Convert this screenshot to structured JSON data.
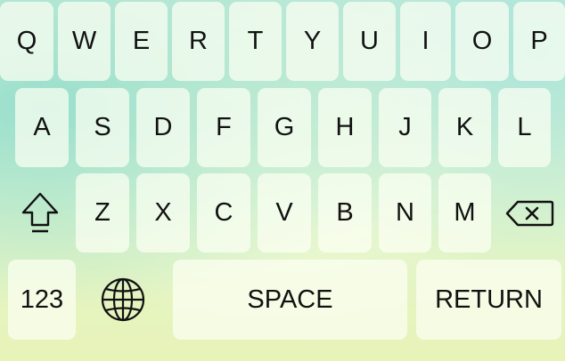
{
  "keyboard": {
    "row1": [
      "Q",
      "W",
      "E",
      "R",
      "T",
      "Y",
      "U",
      "I",
      "O",
      "P"
    ],
    "row2": [
      "A",
      "S",
      "D",
      "F",
      "G",
      "H",
      "J",
      "K",
      "L"
    ],
    "row3": [
      "Z",
      "X",
      "C",
      "V",
      "B",
      "N",
      "M"
    ],
    "numbers_label": "123",
    "space_label": "SPACE",
    "return_label": "RETURN",
    "icons": {
      "shift": "shift-arrow-icon",
      "backspace": "backspace-icon",
      "globe": "globe-icon"
    }
  }
}
